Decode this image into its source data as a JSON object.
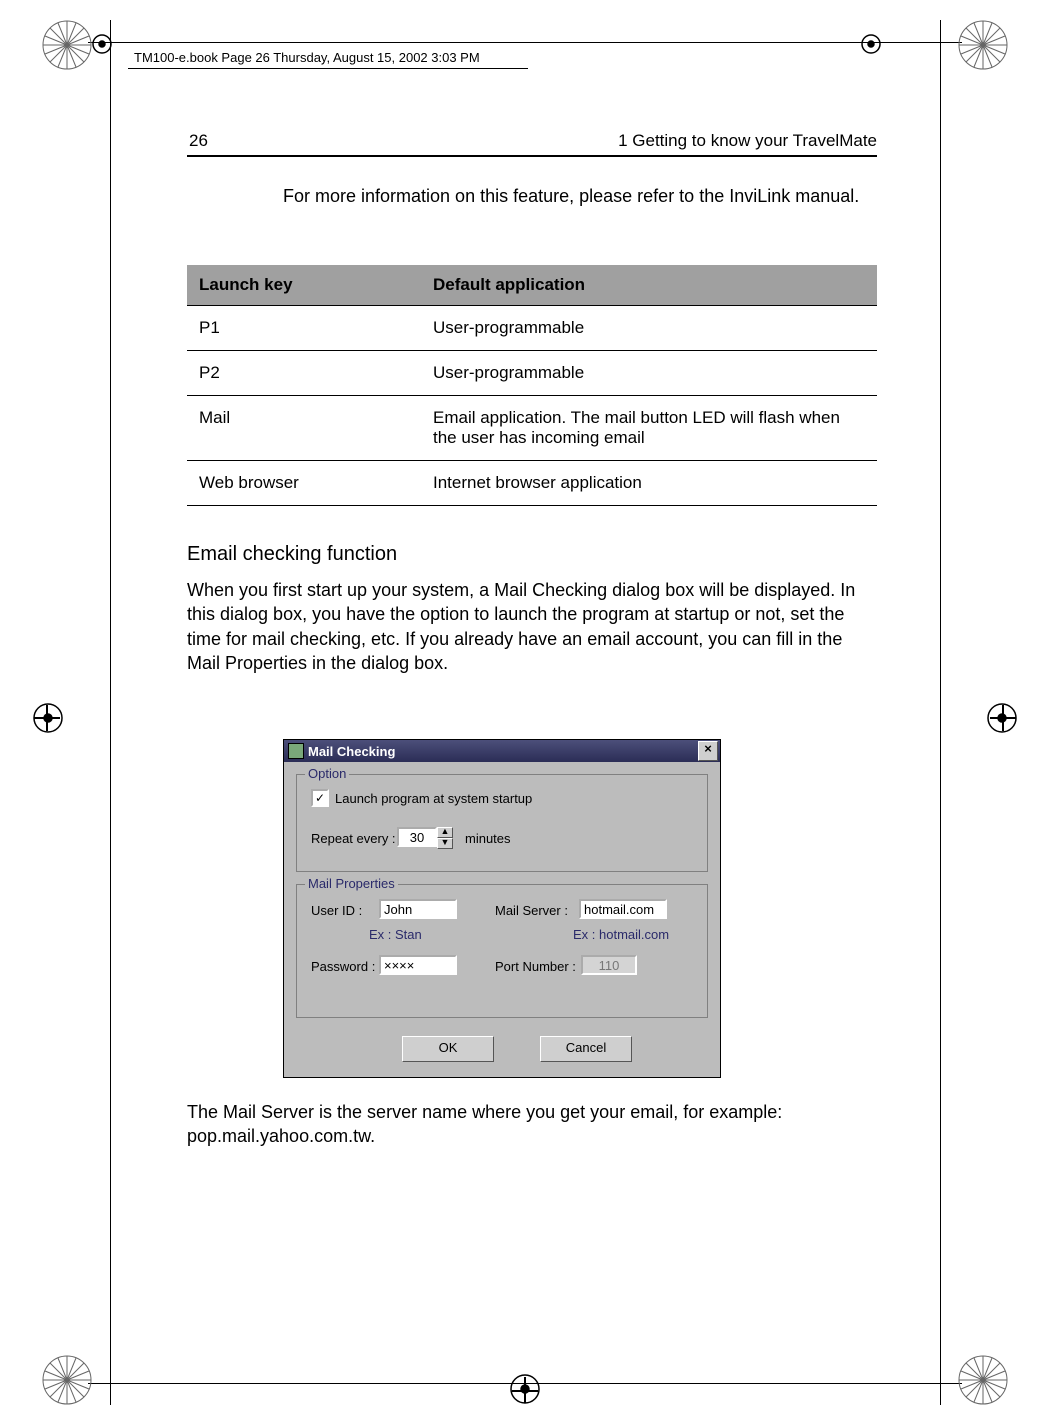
{
  "page": {
    "number": "26",
    "chapter": "1 Getting to know your TravelMate",
    "running_header": "TM100-e.book  Page 26  Thursday, August 15, 2002  3:03 PM"
  },
  "intro": "For more information on this feature, please refer to the InviLink manual.",
  "table": {
    "headers": [
      "Launch key",
      "Default application"
    ],
    "rows": [
      {
        "key": "P1",
        "app": "User-programmable"
      },
      {
        "key": "P2",
        "app": "User-programmable"
      },
      {
        "key": "Mail",
        "app": "Email application.  The mail button LED will flash when the user has incoming email"
      },
      {
        "key": "Web browser",
        "app": "Internet browser application"
      }
    ]
  },
  "section_title": "Email checking function",
  "section_body": "When you first start up your system, a Mail Checking dialog box will be displayed.  In this dialog box, you have the option to launch the program at startup or not, set the time for mail checking, etc.  If you already have an email account, you can fill in the Mail Properties in the dialog box.",
  "dialog": {
    "title": "Mail Checking",
    "option": {
      "legend": "Option",
      "launch_label": "Launch program at system startup",
      "launch_checked": "✓",
      "repeat_label": "Repeat every :",
      "repeat_value": "30",
      "repeat_unit": "minutes"
    },
    "mail": {
      "legend": "Mail Properties",
      "userid_label": "User ID    :",
      "userid_value": "John",
      "userid_ex": "Ex : Stan",
      "server_label": "Mail Server   :",
      "server_value": "hotmail.com",
      "server_ex": "Ex : hotmail.com",
      "password_label": "Password  :",
      "password_value": "××××",
      "port_label": "Port Number :",
      "port_value": "110"
    },
    "ok": "OK",
    "cancel": "Cancel"
  },
  "closing": "The Mail Server is the server name where you get your email, for example: pop.mail.yahoo.com.tw."
}
